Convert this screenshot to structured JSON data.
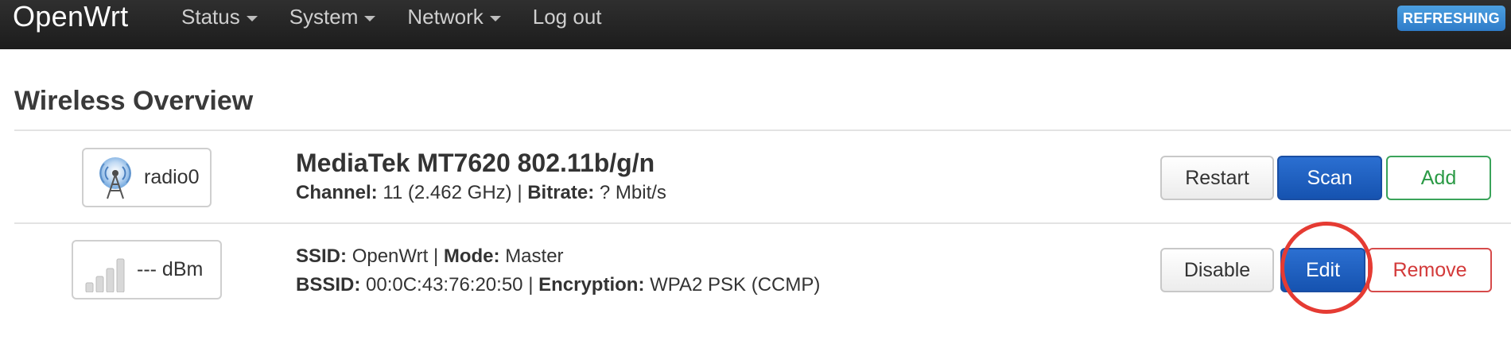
{
  "navbar": {
    "brand": "OpenWrt",
    "items": [
      {
        "label": "Status",
        "has_dropdown": true
      },
      {
        "label": "System",
        "has_dropdown": true
      },
      {
        "label": "Network",
        "has_dropdown": true
      },
      {
        "label": "Log out",
        "has_dropdown": false
      }
    ],
    "refreshing_badge": "REFRESHING"
  },
  "page": {
    "title": "Wireless Overview"
  },
  "radio": {
    "badge_label": "radio0",
    "icon": "radio-tower-icon",
    "title": "MediaTek MT7620 802.11b/g/n",
    "channel_label": "Channel:",
    "channel_value": "11 (2.462 GHz)",
    "separator": "|",
    "bitrate_label": "Bitrate:",
    "bitrate_value": "? Mbit/s",
    "buttons": {
      "restart": "Restart",
      "scan": "Scan",
      "add": "Add"
    }
  },
  "network": {
    "badge_label": "--- dBm",
    "icon": "signal-strength-icon",
    "ssid_label": "SSID:",
    "ssid_value": "OpenWrt",
    "mode_label": "Mode:",
    "mode_value": "Master",
    "bssid_label": "BSSID:",
    "bssid_value": "00:0C:43:76:20:50",
    "encryption_label": "Encryption:",
    "encryption_value": "WPA2 PSK (CCMP)",
    "separator": "|",
    "buttons": {
      "disable": "Disable",
      "edit": "Edit",
      "remove": "Remove"
    }
  },
  "colors": {
    "navbar_bg": "#222222",
    "primary_button": "#1a5fc0",
    "add_button": "#2a9a45",
    "remove_button": "#d33a3a",
    "highlight_circle": "#e53b33"
  }
}
